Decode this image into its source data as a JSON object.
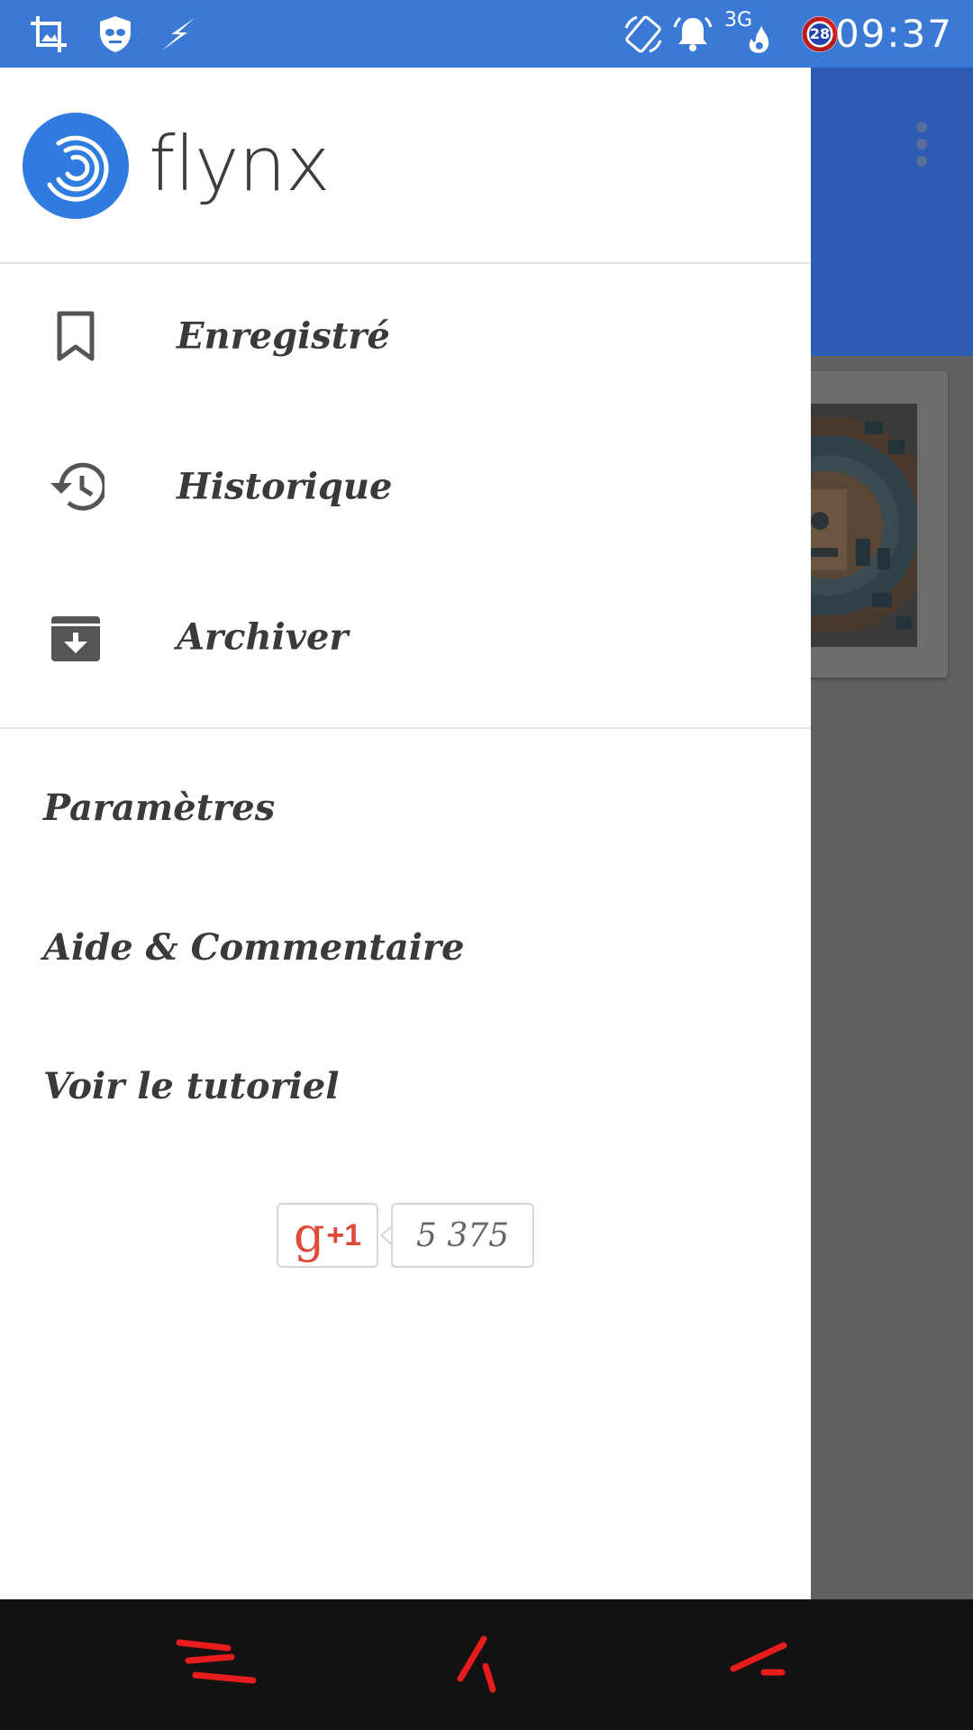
{
  "status_bar": {
    "time": "09:37",
    "left_icons": [
      "crop-icon",
      "security-shield-icon",
      "flash-icon"
    ],
    "right_icons": [
      "screen-rotation-icon",
      "alarm-bell-icon",
      "network-3g-icon",
      "battery-circle-icon"
    ],
    "network_label": "3G",
    "battery_level": "28",
    "background_color": "#3a79d6"
  },
  "drawer": {
    "brand_name": "flynx",
    "brand_color": "#2f7be0",
    "primary_items": [
      {
        "icon": "bookmark-icon",
        "label": "Enregistré"
      },
      {
        "icon": "history-icon",
        "label": "Historique"
      },
      {
        "icon": "archive-icon",
        "label": "Archiver"
      }
    ],
    "secondary_items": [
      {
        "label": "Paramètres"
      },
      {
        "label": "Aide & Commentaire"
      },
      {
        "label": "Voir le tutoriel"
      }
    ],
    "gplus": {
      "label_g": "g",
      "label_plus": "+1",
      "count": "5 375"
    }
  },
  "background_app": {
    "app_bar_color": "#2d5bb2",
    "overflow_icon": "more-vert-icon"
  },
  "nav_bar": {
    "buttons": [
      "recent-apps-icon",
      "home-icon",
      "back-icon"
    ],
    "accent_color": "#e81c1c"
  }
}
